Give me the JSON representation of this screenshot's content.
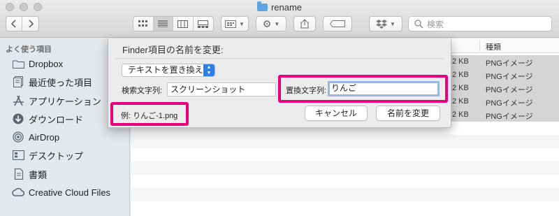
{
  "window": {
    "title": "rename"
  },
  "toolbar": {
    "search_placeholder": "検索"
  },
  "sidebar": {
    "heading": "よく使う項目",
    "items": [
      {
        "label": "Dropbox",
        "icon": "folder-icon"
      },
      {
        "label": "最近使った項目",
        "icon": "recents-icon"
      },
      {
        "label": "アプリケーション",
        "icon": "applications-icon"
      },
      {
        "label": "ダウンロード",
        "icon": "download-icon"
      },
      {
        "label": "AirDrop",
        "icon": "airdrop-icon"
      },
      {
        "label": "デスクトップ",
        "icon": "desktop-icon"
      },
      {
        "label": "書類",
        "icon": "documents-icon"
      },
      {
        "label": "Creative Cloud Files",
        "icon": "creative-cloud-icon"
      }
    ]
  },
  "list": {
    "kind_header": "種類",
    "rows": [
      {
        "size": "2 KB",
        "kind": "PNGイメージ"
      },
      {
        "size": "2 KB",
        "kind": "PNGイメージ"
      },
      {
        "size": "2 KB",
        "kind": "PNGイメージ"
      },
      {
        "size": "2 KB",
        "kind": "PNGイメージ"
      },
      {
        "size": "2 KB",
        "kind": "PNGイメージ"
      }
    ]
  },
  "dialog": {
    "title": "Finder項目の名前を変更:",
    "mode_selected": "テキストを置き換える",
    "find_label": "検索文字列:",
    "find_value": "スクリーンショット",
    "replace_label": "置換文字列:",
    "replace_value": "りんご",
    "example": "例: りんご-1.png",
    "cancel_label": "キャンセル",
    "rename_label": "名前を変更"
  },
  "colors": {
    "highlight": "#e8007d",
    "accent": "#2f7fe8",
    "focus_ring": "#9db7e5"
  }
}
